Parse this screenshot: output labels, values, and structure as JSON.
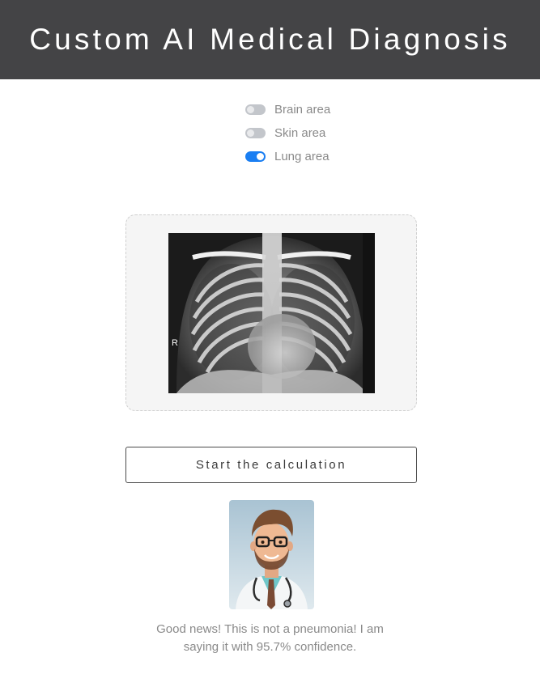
{
  "header": {
    "title": "Custom AI Medical Diagnosis"
  },
  "areas": [
    {
      "label": "Brain area",
      "checked": false
    },
    {
      "label": "Skin area",
      "checked": false
    },
    {
      "label": "Lung area",
      "checked": true
    }
  ],
  "upload": {
    "image_marker": "R"
  },
  "actions": {
    "start_label": "Start the calculation"
  },
  "result": {
    "line1": "Good news! This is not a pneumonia! I am",
    "line2": "saying it with 95.7% confidence."
  },
  "colors": {
    "header_bg": "#444446",
    "toggle_on": "#1a7ef2",
    "toggle_off": "#c3c6cb",
    "muted_text": "#8a8a8a"
  },
  "icons": {
    "toggle": "switch-icon",
    "doctor": "doctor-avatar"
  }
}
